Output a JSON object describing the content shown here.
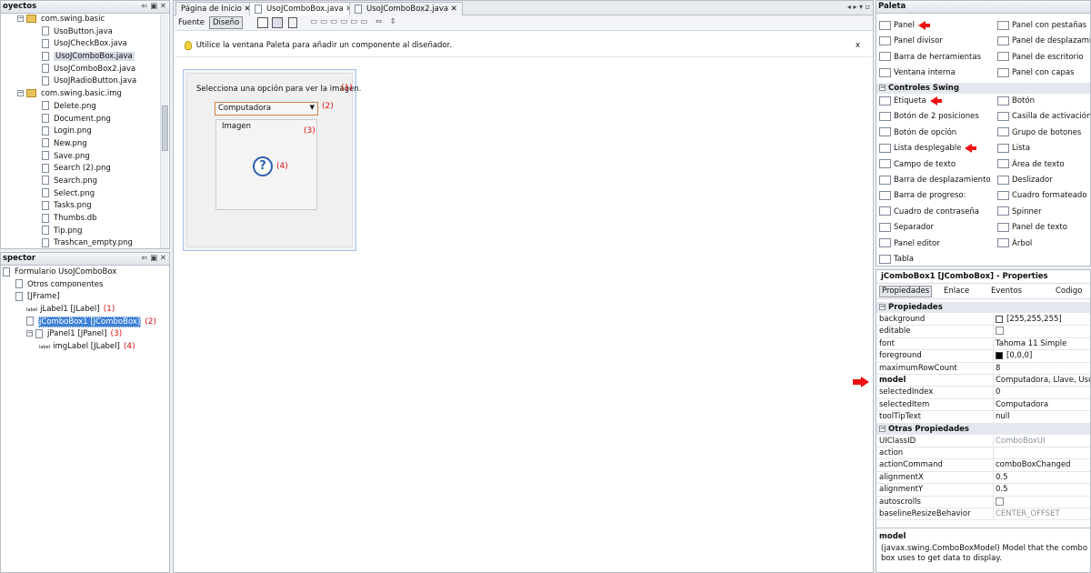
{
  "projects": {
    "title": "oyectos",
    "items": [
      {
        "label": "com.swing.basic",
        "type": "pkg",
        "indent": 18,
        "toggle": "−"
      },
      {
        "label": "UsoButton.java",
        "type": "file",
        "indent": 45
      },
      {
        "label": "UsoJCheckBox.java",
        "type": "file",
        "indent": 45
      },
      {
        "label": "UsoJComboBox.java",
        "type": "file",
        "indent": 45,
        "selected": true
      },
      {
        "label": "UsoJComboBox2.java",
        "type": "file",
        "indent": 45
      },
      {
        "label": "UsoJRadioButton.java",
        "type": "file",
        "indent": 45
      },
      {
        "label": "com.swing.basic.img",
        "type": "pkg",
        "indent": 18,
        "toggle": "−"
      },
      {
        "label": "Delete.png",
        "type": "file",
        "indent": 45
      },
      {
        "label": "Document.png",
        "type": "file",
        "indent": 45
      },
      {
        "label": "Login.png",
        "type": "file",
        "indent": 45
      },
      {
        "label": "New.png",
        "type": "file",
        "indent": 45
      },
      {
        "label": "Save.png",
        "type": "file",
        "indent": 45
      },
      {
        "label": "Search (2).png",
        "type": "file",
        "indent": 45
      },
      {
        "label": "Search.png",
        "type": "file",
        "indent": 45
      },
      {
        "label": "Select.png",
        "type": "file",
        "indent": 45
      },
      {
        "label": "Tasks.png",
        "type": "file",
        "indent": 45
      },
      {
        "label": "Thumbs.db",
        "type": "file",
        "indent": 45
      },
      {
        "label": "Tip.png",
        "type": "file",
        "indent": 45
      },
      {
        "label": "Trashcan_empty.png",
        "type": "file",
        "indent": 45
      }
    ]
  },
  "inspector": {
    "title": "spector",
    "items": [
      {
        "label": "Formulario UsoJComboBox",
        "indent": 2
      },
      {
        "label": "Otros componentes",
        "indent": 16
      },
      {
        "label": "[JFrame]",
        "indent": 16
      },
      {
        "label": "jLabel1 [JLabel]",
        "indent": 28,
        "num": "(1)",
        "icon": "label"
      },
      {
        "label": "jComboBox1 [JComboBox]",
        "indent": 28,
        "num": "(2)",
        "selected": true
      },
      {
        "label": "jPanel1 [JPanel]",
        "indent": 28,
        "num": "(3)",
        "toggle": "−"
      },
      {
        "label": "imgLabel [JLabel]",
        "indent": 42,
        "num": "(4)",
        "icon": "label"
      }
    ]
  },
  "editor": {
    "tabs": [
      "Página de Inicio",
      "UsoJComboBox.java",
      "UsoJComboBox2.java"
    ],
    "toolbar": {
      "source": "Fuente",
      "design": "Diseño"
    },
    "hint": "Utilice la ventana Paleta para añadir un componente al diseñador.",
    "hint_close": "x",
    "form": {
      "label": "Selecciona una opción para ver la imagen.",
      "label_num": "(1)",
      "combo_value": "Computadora",
      "combo_num": "(2)",
      "panel_label": "Imagen",
      "panel_num": "(3)",
      "img_num": "(4)"
    }
  },
  "palette": {
    "title": "Paleta",
    "top_left": [
      {
        "label": "Panel",
        "arrow": true
      },
      {
        "label": "Panel divisor"
      },
      {
        "label": "Barra de herramientas"
      },
      {
        "label": "Ventana interna"
      }
    ],
    "top_right": [
      {
        "label": "Panel con pestañas"
      },
      {
        "label": "Panel de desplazamiento"
      },
      {
        "label": "Panel de escritorio"
      },
      {
        "label": "Panel con capas"
      }
    ],
    "section": "Controles Swing",
    "ctrl_left": [
      {
        "label": "Etiqueta",
        "arrow": true
      },
      {
        "label": "Botón de 2 posiciones"
      },
      {
        "label": "Botón de opción"
      },
      {
        "label": "Lista desplegable",
        "arrow": true
      },
      {
        "label": "Campo de texto"
      },
      {
        "label": "Barra de desplazamiento"
      },
      {
        "label": "Barra de progreso:"
      },
      {
        "label": "Cuadro de contraseña"
      },
      {
        "label": "Separador"
      },
      {
        "label": "Panel editor"
      },
      {
        "label": "Tabla"
      }
    ],
    "ctrl_right": [
      {
        "label": "Botón"
      },
      {
        "label": "Casilla de activación"
      },
      {
        "label": "Grupo de botones"
      },
      {
        "label": "Lista"
      },
      {
        "label": "Área de texto"
      },
      {
        "label": "Deslizador"
      },
      {
        "label": "Cuadro formateado"
      },
      {
        "label": "Spinner"
      },
      {
        "label": "Panel de texto"
      },
      {
        "label": "Árbol"
      }
    ]
  },
  "properties": {
    "title": "jComboBox1 [JComboBox] - Properties",
    "tabs": [
      "Propiedades",
      "Enlace",
      "Eventos",
      "Codigo"
    ],
    "section1": "Propiedades",
    "rows1": [
      {
        "k": "background",
        "v": "[255,255,255]",
        "swatch": "#ffffff"
      },
      {
        "k": "editable",
        "v": "",
        "check": true
      },
      {
        "k": "font",
        "v": "Tahoma 11 Simple"
      },
      {
        "k": "foreground",
        "v": "[0,0,0]",
        "swatch": "#000000"
      },
      {
        "k": "maximumRowCount",
        "v": "8"
      },
      {
        "k": "model",
        "v": "Computadora, Llave, Usuario",
        "bold": true
      },
      {
        "k": "selectedIndex",
        "v": "0"
      },
      {
        "k": "selectedItem",
        "v": "Computadora"
      },
      {
        "k": "toolTipText",
        "v": "null"
      }
    ],
    "section2": "Otras Propiedades",
    "rows2": [
      {
        "k": "UIClassID",
        "v": "ComboBoxUI",
        "grey": true
      },
      {
        "k": "action",
        "v": ""
      },
      {
        "k": "actionCommand",
        "v": "comboBoxChanged"
      },
      {
        "k": "alignmentX",
        "v": "0.5"
      },
      {
        "k": "alignmentY",
        "v": "0.5"
      },
      {
        "k": "autoscrolls",
        "v": "",
        "check": true
      },
      {
        "k": "baselineResizeBehavior",
        "v": "CENTER_OFFSET",
        "grey": true
      }
    ],
    "desc_title": "model",
    "desc_text": "(javax.swing.ComboBoxModel) Model that the combo box uses to get data to display."
  }
}
